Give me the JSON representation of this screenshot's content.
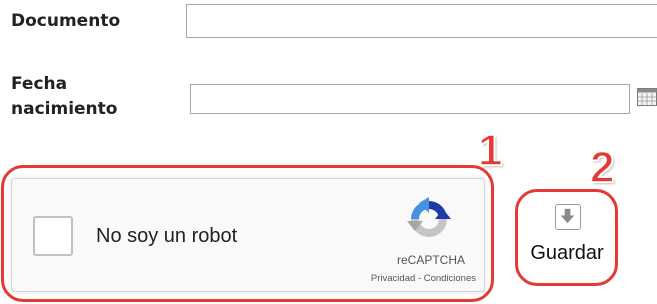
{
  "form": {
    "documento_label": "Documento",
    "documento_value": "",
    "fecha_label_line1": "Fecha",
    "fecha_label_line2": "nacimiento",
    "fecha_value": "",
    "calendar_icon": "calendar-icon"
  },
  "recaptcha": {
    "checkbox_label": "No soy un robot",
    "brand": "reCAPTCHA",
    "links": "Privacidad - Condiciones",
    "logo_icon": "recaptcha-logo-icon",
    "checked": false
  },
  "save": {
    "label": "Guardar",
    "icon": "save-download-icon"
  },
  "annotations": {
    "marker_1": "1",
    "marker_2": "2",
    "color": "#e53935"
  }
}
